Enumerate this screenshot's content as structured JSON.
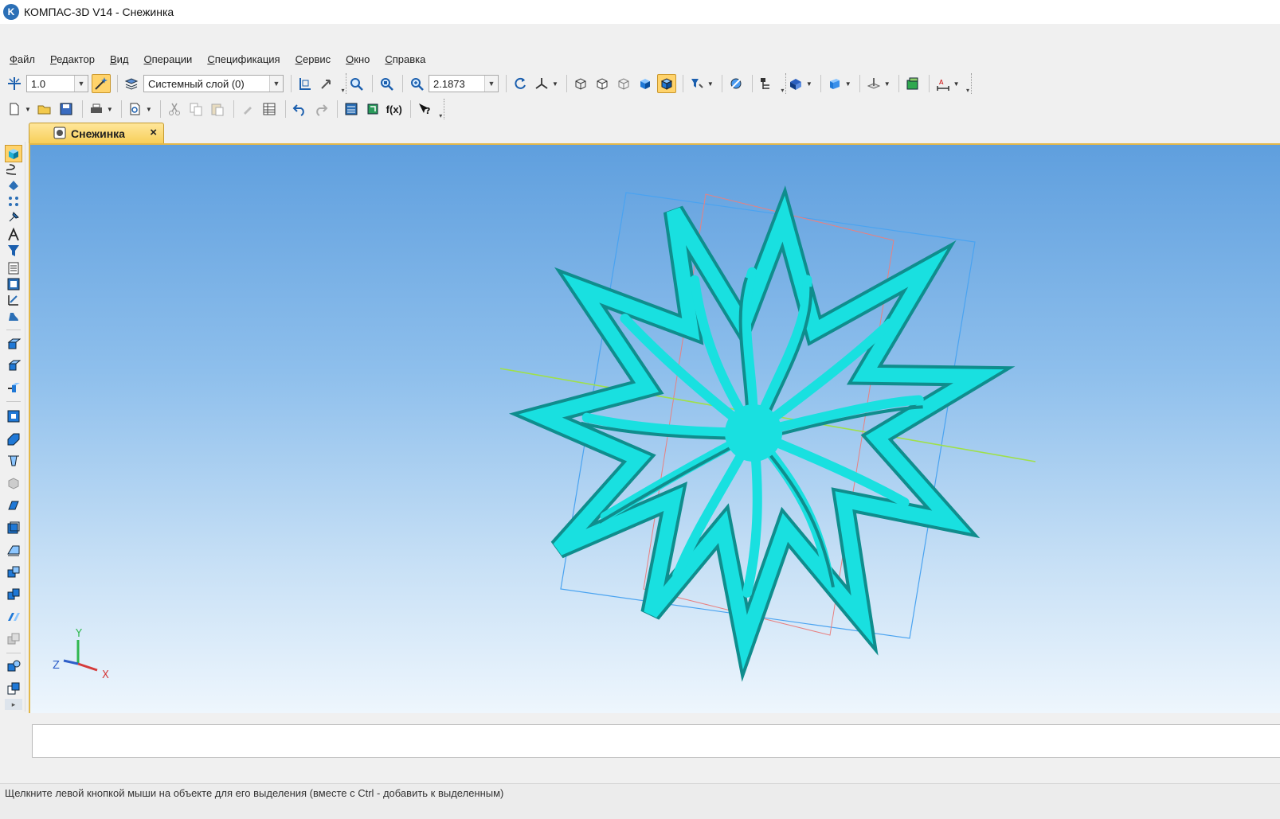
{
  "window": {
    "title": "КОМПАС-3D V14 - Снежинка",
    "logo_letter": "K"
  },
  "menu": [
    "Файл",
    "Редактор",
    "Вид",
    "Операции",
    "Спецификация",
    "Сервис",
    "Окно",
    "Справка"
  ],
  "toolbar": {
    "step_value": "1.0",
    "layer_value": "Системный слой (0)",
    "zoom_value": "2.1873",
    "fx_label": "f(x)"
  },
  "tab": {
    "label": "Снежинка",
    "close": "×"
  },
  "triad": {
    "x": "X",
    "y": "Y",
    "z": "Z"
  },
  "status": {
    "hint": "Щелкните левой кнопкой мыши на объекте для его выделения (вместе с Ctrl - добавить к выделенным)"
  },
  "colors": {
    "model": "#19e0e0",
    "model_dark": "#0f9a9a",
    "frame_blue": "#4aa3f0",
    "frame_red": "#e88080",
    "axis_green": "#9fe04a"
  }
}
